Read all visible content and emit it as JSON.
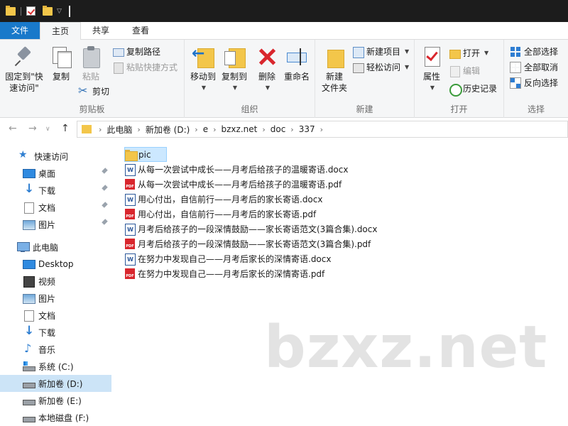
{
  "ribbon_tabs": {
    "file": "文件",
    "home": "主页",
    "share": "共享",
    "view": "查看"
  },
  "clipboard": {
    "pin_line1": "固定到\"快",
    "pin_line2": "速访问\"",
    "copy": "复制",
    "paste": "粘贴",
    "copy_path": "复制路径",
    "paste_shortcut": "粘贴快捷方式",
    "cut": "剪切",
    "label": "剪贴板"
  },
  "organize": {
    "move_to": "移动到",
    "copy_to": "复制到",
    "delete": "删除",
    "rename": "重命名",
    "label": "组织"
  },
  "new_group": {
    "new_folder_line1": "新建",
    "new_folder_line2": "文件夹",
    "new_item": "新建项目",
    "easy_access": "轻松访问",
    "label": "新建"
  },
  "open_group": {
    "properties": "属性",
    "open": "打开",
    "edit": "编辑",
    "history": "历史记录",
    "label": "打开"
  },
  "select_group": {
    "select_all": "全部选择",
    "select_none": "全部取消",
    "invert": "反向选择",
    "label": "选择"
  },
  "address": {
    "crumbs": [
      "此电脑",
      "新加卷 (D:)",
      "e",
      "bzxz.net",
      "doc",
      "337"
    ]
  },
  "sidebar": {
    "quick_access": "快速访问",
    "desktop_pinned": "桌面",
    "downloads_pinned": "下载",
    "documents_pinned": "文档",
    "pictures_pinned": "图片",
    "this_pc": "此电脑",
    "desktop": "Desktop",
    "videos": "视频",
    "pictures": "图片",
    "documents": "文档",
    "downloads": "下载",
    "music": "音乐",
    "drive_c": "系统 (C:)",
    "drive_d": "新加卷 (D:)",
    "drive_e": "新加卷 (E:)",
    "drive_f": "本地磁盘 (F:)"
  },
  "files": [
    {
      "name": "pic",
      "type": "folder"
    },
    {
      "name": "从每一次尝试中成长——月考后给孩子的温暖寄语.docx",
      "type": "docx"
    },
    {
      "name": "从每一次尝试中成长——月考后给孩子的温暖寄语.pdf",
      "type": "pdf"
    },
    {
      "name": "用心付出，自信前行——月考后的家长寄语.docx",
      "type": "docx"
    },
    {
      "name": "用心付出，自信前行——月考后的家长寄语.pdf",
      "type": "pdf"
    },
    {
      "name": "月考后给孩子的一段深情鼓励——家长寄语范文(3篇合集).docx",
      "type": "docx"
    },
    {
      "name": "月考后给孩子的一段深情鼓励——家长寄语范文(3篇合集).pdf",
      "type": "pdf"
    },
    {
      "name": "在努力中发现自己——月考后家长的深情寄语.docx",
      "type": "docx"
    },
    {
      "name": "在努力中发现自己——月考后家长的深情寄语.pdf",
      "type": "pdf"
    }
  ],
  "watermark": "bzxz.net",
  "colors": {
    "accent": "#1979ca",
    "selection": "#cce8ff",
    "folder": "#f3c64a",
    "pdf": "#d9262d",
    "docx": "#2b579a"
  }
}
